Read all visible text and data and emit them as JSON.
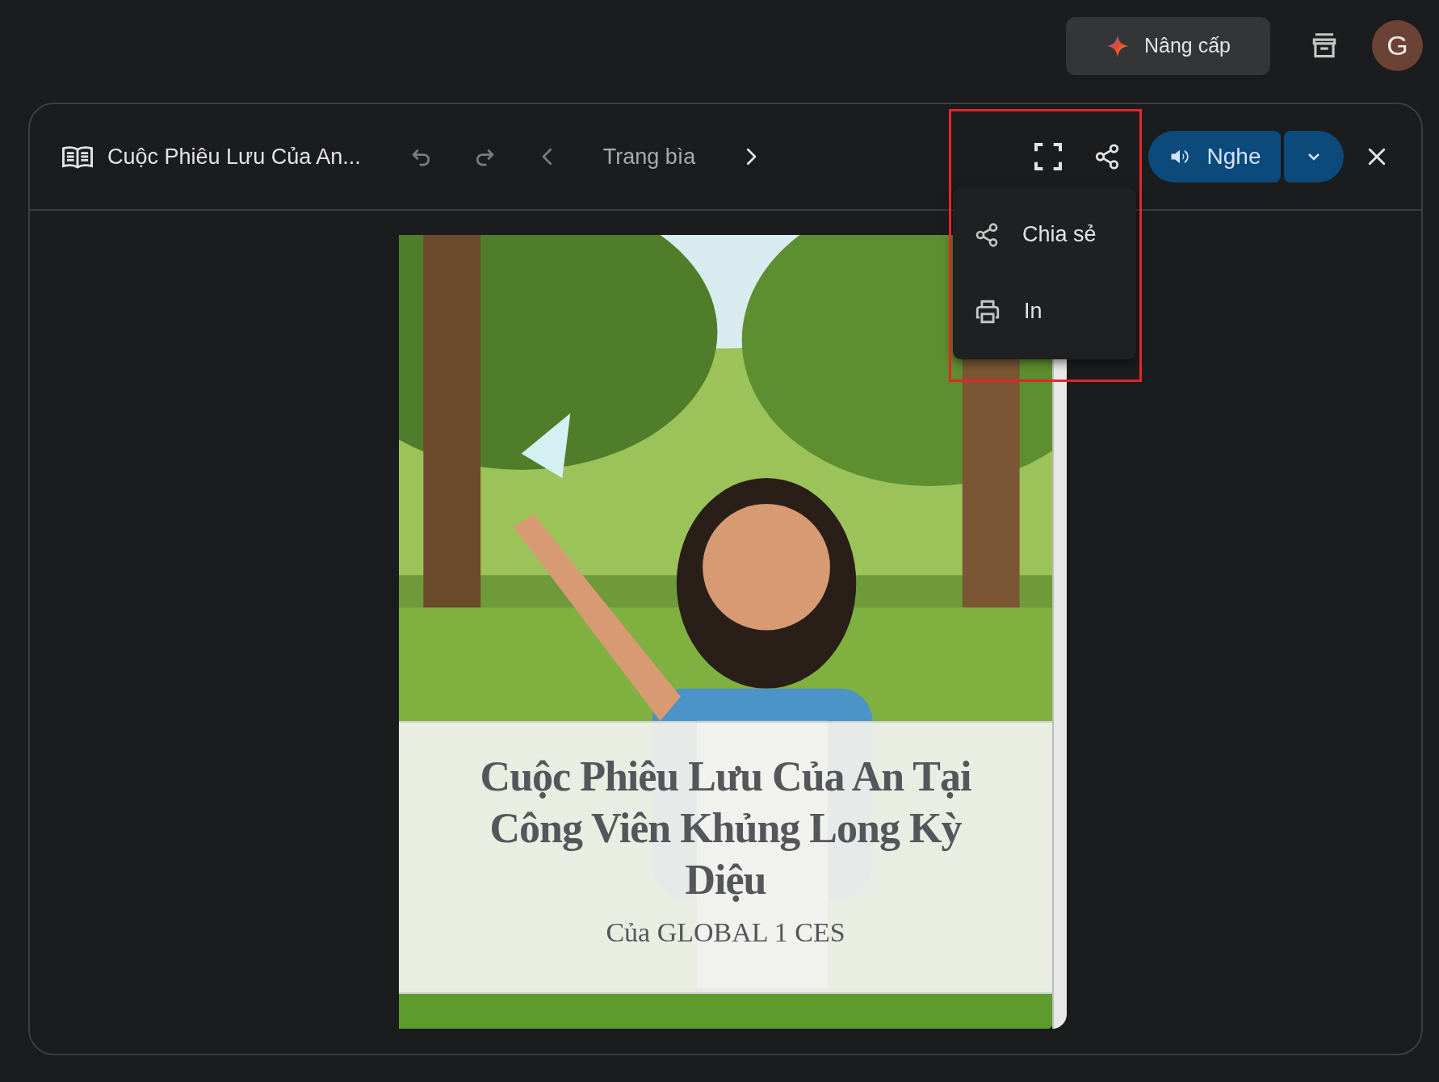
{
  "top_bar": {
    "upgrade_button": "Nâng cấp",
    "avatar_letter": "G"
  },
  "reader": {
    "title": "Cuộc Phiêu Lưu Của An...",
    "controls": [
      {
        "kind": "undo",
        "disabled": true
      },
      {
        "kind": "redo",
        "disabled": true
      },
      {
        "kind": "prev",
        "disabled": true
      },
      {
        "kind": "page",
        "label": "Trang bìa"
      },
      {
        "kind": "next",
        "disabled": false
      }
    ],
    "listen_button": "Nghe",
    "share_menu": {
      "open": true,
      "items": [
        {
          "kind": "share",
          "label": "Chia sẻ"
        },
        {
          "kind": "print",
          "label": "In"
        }
      ]
    },
    "cover": {
      "kind": "picture",
      "title": "Cuộc Phiêu Lưu Của An Tại Công Viên Khủng Long Kỳ Diệu",
      "byline": "Của GLOBAL 1 CES"
    }
  }
}
